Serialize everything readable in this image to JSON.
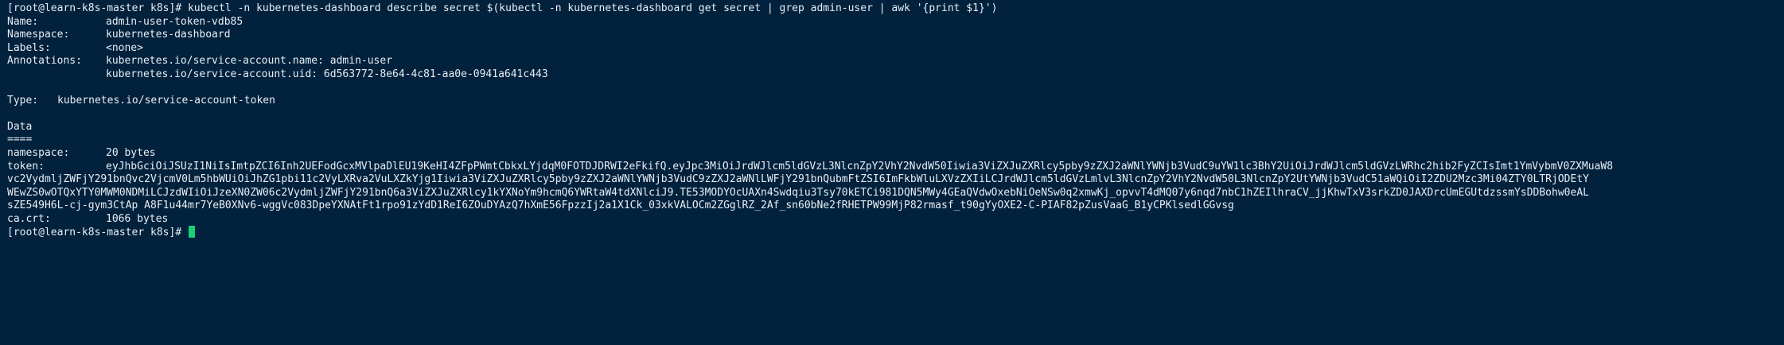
{
  "terminal": {
    "command_line": "[root@learn-k8s-master k8s]# kubectl -n kubernetes-dashboard describe secret $(kubectl -n kubernetes-dashboard get secret | grep admin-user | awk '{print $1}')",
    "name_key": "Name:",
    "name_val": "admin-user-token-vdb85",
    "namespace_key": "Namespace:",
    "namespace_val": "kubernetes-dashboard",
    "labels_key": "Labels:",
    "labels_val": "<none>",
    "annotations_key": "Annotations:",
    "annotation_1": "kubernetes.io/service-account.name: admin-user",
    "annotation_2": "kubernetes.io/service-account.uid: 6d563772-8e64-4c81-aa0e-0941a641c443",
    "type_key": "Type:",
    "type_val": "kubernetes.io/service-account-token",
    "data_heading": "Data",
    "data_rule": "====",
    "ns_data_key": "namespace:",
    "ns_data_val": "20 bytes",
    "token_key": "token:",
    "token_line_1": "eyJhbGciOiJSUzI1NiIsImtpZCI6Inh2UEFodGcxMVlpaDlEU19KeHI4ZFpPWmtCbkxLYjdqM0FOTDJDRWI2eFkifQ.eyJpc3MiOiJrdWJlcm5ldGVzL3NlcnZpY2VhY2NvdW50Iiwia3ViZXJuZXRlcy5pby9zZXJ2aWNlYWNjb3VudC9uYW1lc3BhY2UiOiJrdWJlcm5ldGVzLWRhc2hib2FyZCIsImt1YmVybmV0ZXMuaW8",
    "token_line_2": "vc2VydmljZWFjY291bnQvc2VjcmV0Lm5hbWUiOiJhZG1pbi11c2VyLXRva2VuLXZkYjg1Iiwia3ViZXJuZXRlcy5pby9zZXJ2aWNlYWNjb3VudC9zZXJ2aWNlLWFjY291bnQubmFtZSI6ImFkbWluLXVzZXIiLCJrdWJlcm5ldGVzLmlvL3NlcnZpY2VhY2NvdW50L3NlcnZpY2UtYWNjb3VudC51aWQiOiI2ZDU2Mzc3Mi04ZTY0LTRjODEtY",
    "token_line_3": "WEwZS0wOTQxYTY0MWM0NDMiLCJzdWIiOiJzeXN0ZW06c2VydmljZWFjY291bnQ6a3ViZXJuZXRlcy1kYXNoYm9hcmQ6YWRtaW4tdXNlciJ9.TE53MODYOcUAXn4Swdqiu3Tsy70kETCi981DQN5MWy4GEaQVdwOxebNiOeNSw0q2xmwKj_opvvT4dMQ07y6nqd7nbC1hZEIlhraCV_jjKhwTxV3srkZD0JAXDrcUmEGUtdzssmYsDDBohw0eAL",
    "token_line_4": "sZE549H6L-cj-gym3CtAp A8F1u44mr7YeB0XNv6-wggVc083DpeYXNAtFt1rpo91zYdD1ReI6ZOuDYAzQ7hXmE56FpzzIj2a1X1Ck_03xkVALOCm2ZGglRZ_2Af_sn60bNe2fRHETPW99MjP82rmasf_t90gYyOXE2-C-PIAF82pZusVaaG_B1yCPKlsedlGGvsg",
    "ca_key": "ca.crt:",
    "ca_val": "1066 bytes",
    "prompt": "[root@learn-k8s-master k8s]# "
  }
}
